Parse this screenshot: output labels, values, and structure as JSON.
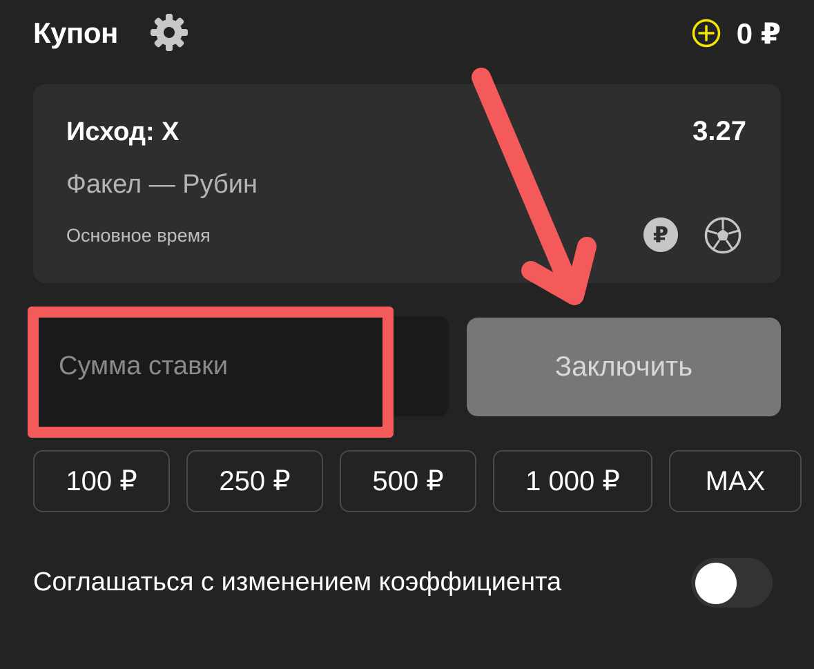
{
  "header": {
    "title": "Купон",
    "settings_icon": "gear-icon",
    "add_funds_icon": "plus-circle-icon",
    "balance": "0 ₽"
  },
  "bet": {
    "outcome": "Исход: X",
    "coefficient": "3.27",
    "match": "Факел — Рубин",
    "period": "Основное время",
    "currency_badge": "₽",
    "sport_icon": "soccer-ball-icon"
  },
  "stake": {
    "placeholder": "Сумма ставки",
    "value": ""
  },
  "submit": {
    "label": "Заключить"
  },
  "quick_amounts": [
    {
      "label": "100 ₽"
    },
    {
      "label": "250 ₽"
    },
    {
      "label": "500 ₽"
    },
    {
      "label": "1 000 ₽"
    },
    {
      "label": "MAX"
    }
  ],
  "odds_change": {
    "label": "Соглашаться с изменением коэффициента",
    "enabled": false
  },
  "colors": {
    "background": "#232323",
    "card": "#2e2e2e",
    "accent_yellow": "#f2e600",
    "highlight_red": "#f55a5a",
    "button_disabled": "#777777"
  }
}
